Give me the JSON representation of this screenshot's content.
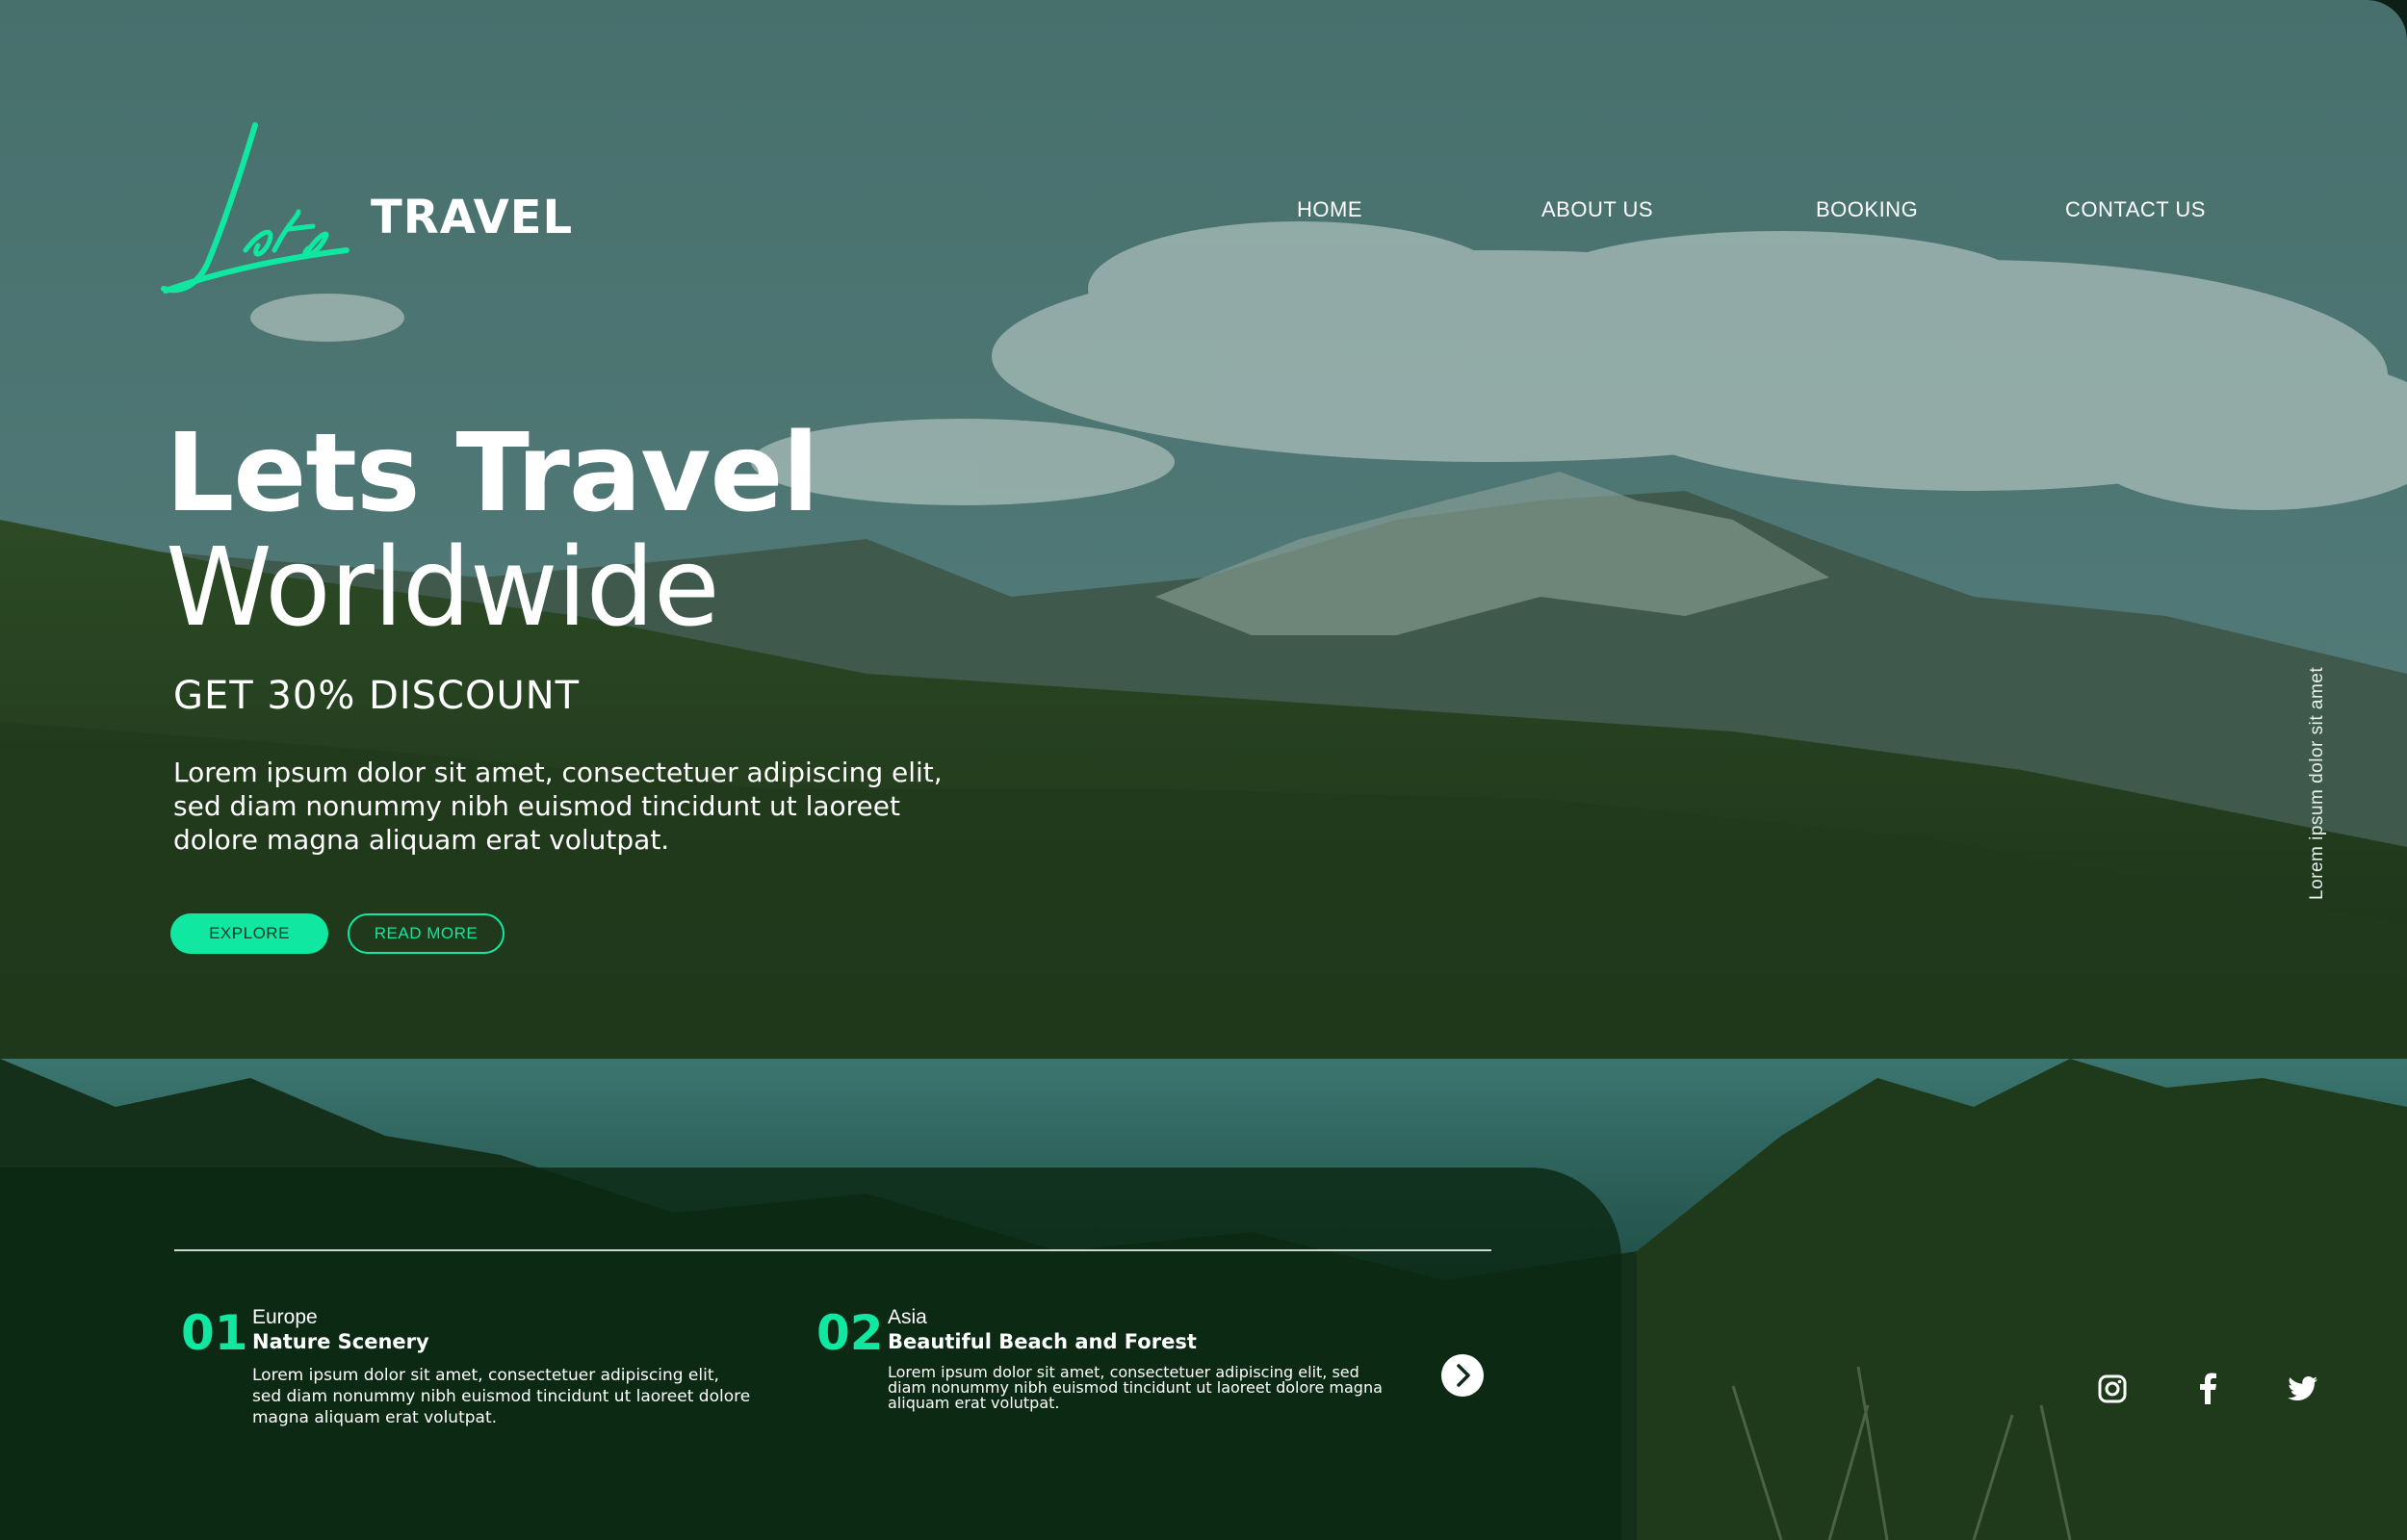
{
  "brand": {
    "script": "Lets",
    "word": "TRAVEL",
    "accent_color": "#10e8a1"
  },
  "nav": {
    "items": [
      {
        "label": "HOME"
      },
      {
        "label": "ABOUT US"
      },
      {
        "label": "BOOKING"
      },
      {
        "label": "CONTACT US"
      }
    ]
  },
  "hero": {
    "title_line1": "Lets Travel",
    "title_line2": "Worldwide",
    "discount": "GET 30% DISCOUNT",
    "description": "Lorem ipsum dolor sit amet, consectetuer adipiscing elit, sed diam nonummy nibh euismod tincidunt ut laoreet dolore magna aliquam erat volutpat.",
    "explore_label": "EXPLORE",
    "read_more_label": "READ MORE"
  },
  "side_text": "Lorem ipsum dolor sit amet",
  "features": [
    {
      "number": "01",
      "region": "Europe",
      "title": "Nature Scenery",
      "description": "Lorem ipsum dolor sit amet, consectetuer adipiscing elit, sed diam nonummy nibh euismod tincidunt ut laoreet dolore magna aliquam erat volutpat."
    },
    {
      "number": "02",
      "region": "Asia",
      "title": "Beautiful Beach and Forest",
      "description": "Lorem ipsum dolor sit amet, consectetuer adipiscing elit, sed diam nonummy nibh euismod tincidunt ut laoreet dolore magna aliquam erat volutpat."
    }
  ],
  "next_icon": "chevron-right-icon",
  "social": [
    {
      "icon": "instagram-icon"
    },
    {
      "icon": "facebook-icon"
    },
    {
      "icon": "twitter-icon"
    }
  ]
}
